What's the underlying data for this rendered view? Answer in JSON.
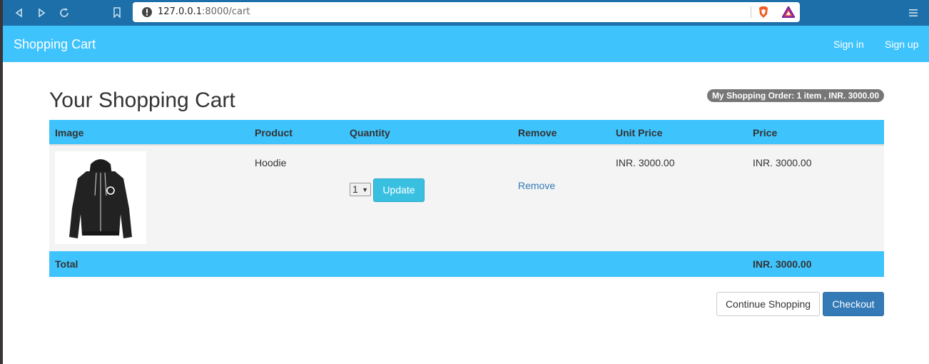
{
  "browser": {
    "url_host": "127.0.0.1",
    "url_path": ":8000/cart"
  },
  "navbar": {
    "brand": "Shopping Cart",
    "sign_in": "Sign in",
    "sign_up": "Sign up"
  },
  "page": {
    "title": "Your Shopping Cart",
    "order_badge": "My Shopping Order: 1 item , INR. 3000.00"
  },
  "table": {
    "headers": [
      "Image",
      "Product",
      "Quantity",
      "Remove",
      "Unit Price",
      "Price"
    ],
    "rows": [
      {
        "product": "Hoodie",
        "quantity": "1",
        "update_label": "Update",
        "remove_label": "Remove",
        "unit_price": "INR. 3000.00",
        "price": "INR. 3000.00"
      }
    ],
    "total_label": "Total",
    "total_value": "INR. 3000.00"
  },
  "actions": {
    "continue_label": "Continue Shopping",
    "checkout_label": "Checkout"
  },
  "colors": {
    "navbar": "#3fc3fc",
    "chrome": "#1c6fa8",
    "checkout": "#337ab7",
    "update": "#39c0e0"
  }
}
